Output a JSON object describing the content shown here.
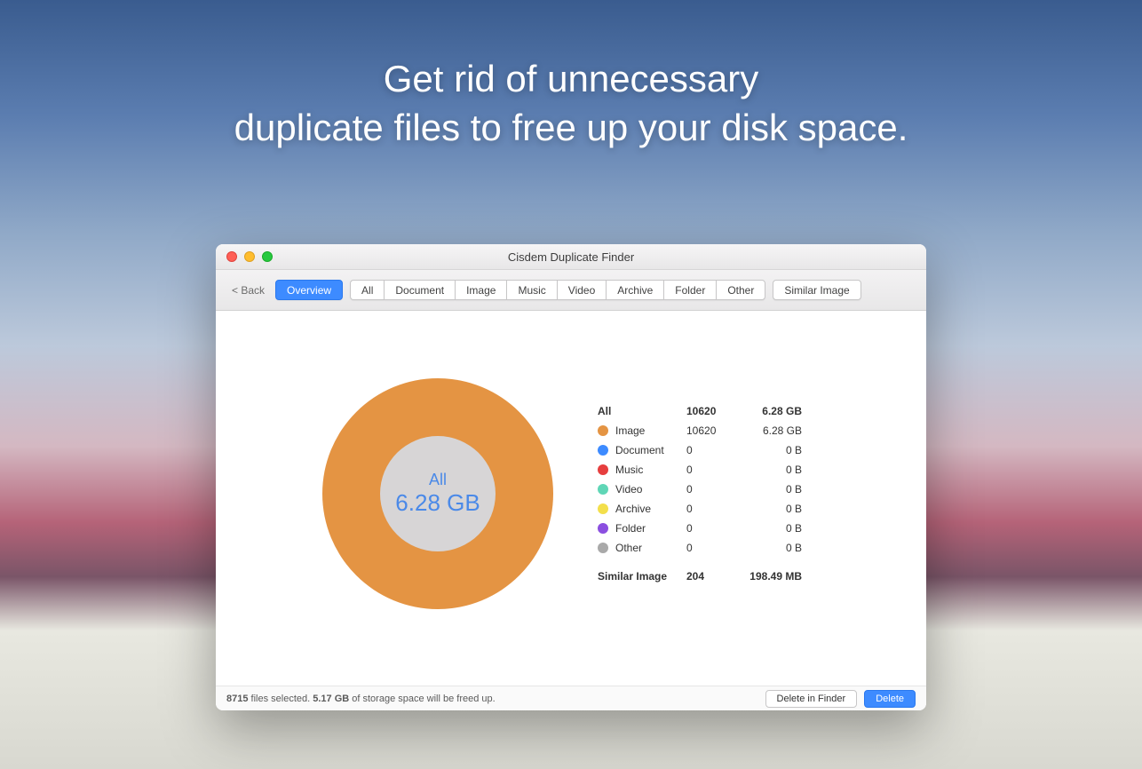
{
  "headline_line1": "Get rid of unnecessary",
  "headline_line2": "duplicate files to free up your disk space.",
  "window": {
    "title": "Cisdem Duplicate Finder",
    "back_label": "< Back"
  },
  "tabs": {
    "overview": "Overview",
    "all": "All",
    "document": "Document",
    "image": "Image",
    "music": "Music",
    "video": "Video",
    "archive": "Archive",
    "folder": "Folder",
    "other": "Other",
    "similar_image": "Similar Image"
  },
  "donut": {
    "label": "All",
    "value": "6.28 GB"
  },
  "stats": {
    "all": {
      "name": "All",
      "count": "10620",
      "size": "6.28 GB"
    },
    "rows": [
      {
        "name": "Image",
        "count": "10620",
        "size": "6.28 GB",
        "color": "#e49443"
      },
      {
        "name": "Document",
        "count": "0",
        "size": "0 B",
        "color": "#3d8bff"
      },
      {
        "name": "Music",
        "count": "0",
        "size": "0 B",
        "color": "#e63e3e"
      },
      {
        "name": "Video",
        "count": "0",
        "size": "0 B",
        "color": "#5fd6b6"
      },
      {
        "name": "Archive",
        "count": "0",
        "size": "0 B",
        "color": "#f3df4b"
      },
      {
        "name": "Folder",
        "count": "0",
        "size": "0 B",
        "color": "#8b4fe0"
      },
      {
        "name": "Other",
        "count": "0",
        "size": "0 B",
        "color": "#a9a9a9"
      }
    ],
    "similar": {
      "name": "Similar Image",
      "count": "204",
      "size": "198.49 MB"
    }
  },
  "footer": {
    "selected_count": "8715",
    "selected_suffix": " files selected. ",
    "freed_size": "5.17 GB",
    "freed_suffix": " of storage space will be freed up.",
    "delete_in_finder": "Delete in Finder",
    "delete": "Delete"
  },
  "chart_data": {
    "type": "pie",
    "title": "All 6.28 GB",
    "categories": [
      "Image",
      "Document",
      "Music",
      "Video",
      "Archive",
      "Folder",
      "Other"
    ],
    "values": [
      6.28,
      0,
      0,
      0,
      0,
      0,
      0
    ],
    "unit": "GB",
    "colors": [
      "#e49443",
      "#3d8bff",
      "#e63e3e",
      "#5fd6b6",
      "#f3df4b",
      "#8b4fe0",
      "#a9a9a9"
    ]
  }
}
